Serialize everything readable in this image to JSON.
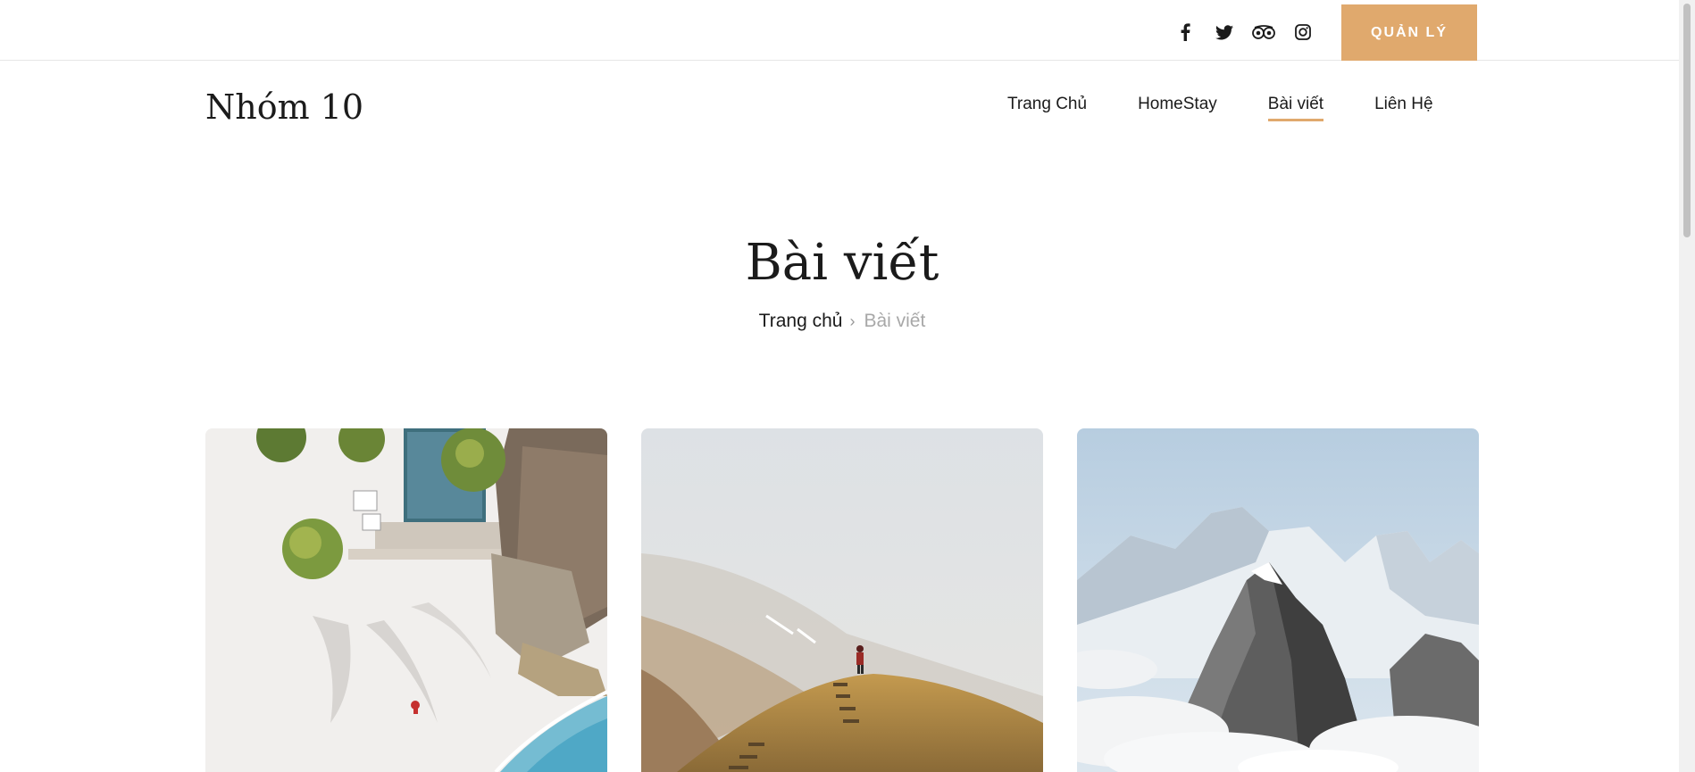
{
  "topbar": {
    "social_icons": [
      "facebook-icon",
      "twitter-icon",
      "tripadvisor-icon",
      "instagram-icon"
    ],
    "admin_button": "QUẢN LÝ"
  },
  "header": {
    "logo": "Nhóm 10",
    "nav": [
      {
        "label": "Trang Chủ",
        "active": false
      },
      {
        "label": "HomeStay",
        "active": false
      },
      {
        "label": "Bài viết",
        "active": true
      },
      {
        "label": "Liên Hệ",
        "active": false
      }
    ]
  },
  "hero": {
    "title": "Bài viết",
    "breadcrumb_home": "Trang chủ",
    "breadcrumb_sep": "›",
    "breadcrumb_current": "Bài viết"
  },
  "cards": [
    {
      "image": "beach-resort-aerial-photo"
    },
    {
      "image": "foggy-mountain-hiker-photo"
    },
    {
      "image": "snowy-mountain-peaks-photo"
    }
  ],
  "colors": {
    "accent": "#e0a96d",
    "text": "#1b1b1b",
    "muted": "#a8a8a8"
  }
}
